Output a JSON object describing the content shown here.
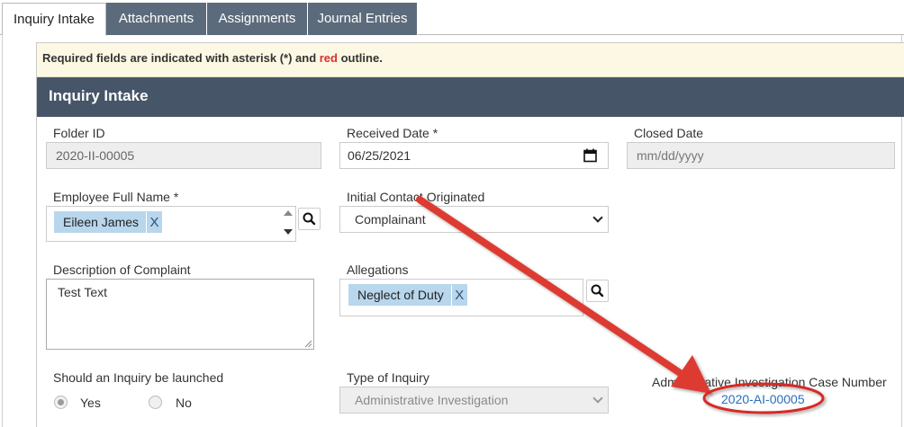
{
  "tabs": [
    {
      "label": "Inquiry Intake",
      "active": true
    },
    {
      "label": "Attachments",
      "active": false
    },
    {
      "label": "Assignments",
      "active": false
    },
    {
      "label": "Journal Entries",
      "active": false
    }
  ],
  "notice": {
    "prefix": "Required fields are indicated with asterisk (*) and ",
    "highlight": "red",
    "suffix": " outline."
  },
  "section_title": "Inquiry Intake",
  "fields": {
    "folder_id": {
      "label": "Folder ID",
      "value": "2020-II-00005"
    },
    "received_date": {
      "label": "Received Date *",
      "value": "06/25/2021"
    },
    "closed_date": {
      "label": "Closed Date",
      "placeholder": "mm/dd/yyyy"
    },
    "employee_full_name": {
      "label": "Employee Full Name *",
      "tag": "Eileen James",
      "remove": "X"
    },
    "initial_contact": {
      "label": "Initial Contact Originated",
      "value": "Complainant"
    },
    "description": {
      "label": "Description of Complaint",
      "value": "Test Text"
    },
    "allegations": {
      "label": "Allegations",
      "tag": "Neglect of Duty",
      "remove": "X"
    },
    "inquiry_launched": {
      "label": "Should an Inquiry be launched",
      "options": [
        "Yes",
        "No"
      ],
      "selected": "Yes"
    },
    "type_of_inquiry": {
      "label": "Type of Inquiry",
      "value": "Administrative Investigation"
    },
    "case_number": {
      "label": "Administrative Investigation Case Number",
      "value": "2020-AI-00005"
    }
  },
  "colors": {
    "tab_bg": "#5c6b7c",
    "header_bg": "#465568",
    "notice_bg": "#fcf8e3",
    "tag_bg": "#b8d6ec",
    "annotation_red": "#d9302c",
    "link": "#2a6ebb"
  },
  "icons": {
    "search": "search-icon",
    "calendar": "calendar-icon",
    "dropdown": "chevron-down-icon"
  }
}
